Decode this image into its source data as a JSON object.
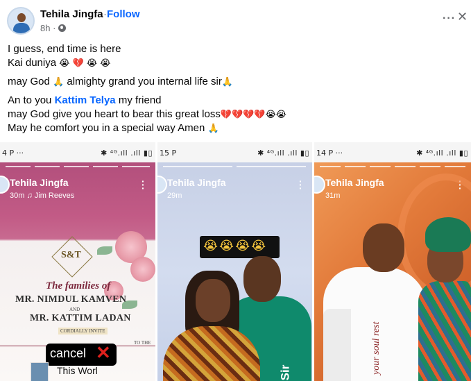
{
  "post": {
    "author": "Tehila Jingfa",
    "separator": "·",
    "follow_label": "Follow",
    "time": "8h ·",
    "audience_icon": "globe-icon",
    "more_icon": "more-horizontal-icon",
    "close_icon": "close-icon",
    "text": {
      "line1": "I guess, end time is here",
      "line2_text": "Kai duniya",
      "line2_emoji": "😭 💔 😭 😭",
      "line3_text": "may God",
      "line3_emoji": "🙏",
      "line3_rest": "almighty grand you internal life sir",
      "line3_emoji2": "🙏",
      "line4_prefix": "An to you",
      "mention": "Kattim Telya",
      "line4_suffix": "my friend",
      "line5_text": "may God give you heart to bear this great loss",
      "line5_emoji": "💔💔💔💔😭😭",
      "line6_text": "May he comfort you in a special way Amen",
      "line6_emoji": "🙏"
    }
  },
  "stories": [
    {
      "status_left": "4 P ···",
      "status_right": "✱ ⁴ᴳ.ıll .ıll ▮▯",
      "author": "Tehila Jingfa",
      "subtitle": "30m ♫ Jim Reeves",
      "content": {
        "monogram": "S&T",
        "line1": "The families of",
        "line2": "MR. NIMDUL KAMVEN",
        "and": "AND",
        "line3": "MR. KATTIM LADAN",
        "cordially": "CORDIALLY INVITE",
        "to_the": "TO THE",
        "cancel_text": "cancel",
        "cancel_mark": "✕",
        "music_text": "This Worl"
      }
    },
    {
      "status_left": "15 P",
      "status_right": "✱ ⁴ᴳ.ıll .ıll ▮▯",
      "author": "Tehila Jingfa",
      "subtitle": "29m",
      "content": {
        "emoji_caption": "😭😭😭😭",
        "side_text": "Sir"
      }
    },
    {
      "status_left": "14 P ···",
      "status_right": "✱ ⁴ᴳ.ıll .ıll ▮▯",
      "author": "Tehila Jingfa",
      "subtitle": "31m",
      "content": {
        "side_text": "your soul rest"
      }
    }
  ],
  "colors": {
    "link": "#0866ff",
    "secondary_text": "#65676b",
    "story1_bg": "#b24f7c",
    "story2_bg": "#c7d0e6",
    "story3_bg": "#e27a3a"
  }
}
